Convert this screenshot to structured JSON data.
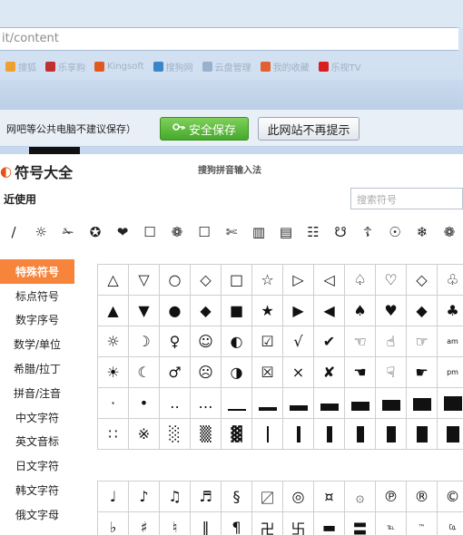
{
  "browser": {
    "url": "it/content",
    "bookmarks": [
      {
        "label": "搜狐",
        "color": "#f0a030"
      },
      {
        "label": "乐享购",
        "color": "#c03030"
      },
      {
        "label": "Kingsoft",
        "color": "#e05a20"
      },
      {
        "label": "搜狗网",
        "color": "#3a86c8"
      },
      {
        "label": "云盘管理",
        "color": "#9ab0cc"
      },
      {
        "label": "我的收藏",
        "color": "#e06030"
      },
      {
        "label": "乐视TV",
        "color": "#d81e1e"
      }
    ],
    "notice": {
      "text": "网吧等公共电脑不建议保存）",
      "save_label": "安全保存",
      "dismiss_label": "此网站不再提示"
    }
  },
  "ime": {
    "title": "符号大全",
    "subtitle": "搜狗拼音输入法",
    "recent_label": "近使用",
    "search_placeholder": "搜索符号",
    "recent_symbols": [
      "/",
      "☼",
      "✁",
      "✪",
      "❤",
      "☐",
      "❁",
      "☐",
      "✄",
      "▥",
      "▤",
      "☷",
      "☋",
      "☦",
      "☉",
      "❄",
      "❁"
    ],
    "sidebar": [
      {
        "label": "特殊符号",
        "active": true
      },
      {
        "label": "标点符号",
        "active": false
      },
      {
        "label": "数字序号",
        "active": false
      },
      {
        "label": "数学/单位",
        "active": false
      },
      {
        "label": "希腊/拉丁",
        "active": false
      },
      {
        "label": "拼音/注音",
        "active": false
      },
      {
        "label": "中文字符",
        "active": false
      },
      {
        "label": "英文音标",
        "active": false
      },
      {
        "label": "日文字符",
        "active": false
      },
      {
        "label": "韩文字符",
        "active": false
      },
      {
        "label": "俄文字母",
        "active": false
      }
    ],
    "grid_rows": [
      [
        "△",
        "▽",
        "○",
        "◇",
        "□",
        "☆",
        "▷",
        "◁",
        "♤",
        "♡",
        "◇",
        "♧"
      ],
      [
        "▲",
        "▼",
        "●",
        "◆",
        "■",
        "★",
        "▶",
        "◀",
        "♠",
        "♥",
        "◆",
        "♣"
      ],
      [
        "☼",
        "☽",
        "♀",
        "☺",
        "◐",
        "☑",
        "√",
        "✔",
        "☜",
        "☝",
        "☞",
        "am"
      ],
      [
        "☀",
        "☾",
        "♂",
        "☹",
        "◑",
        "☒",
        "×",
        "✘",
        "☚",
        "☟",
        "☛",
        "pm"
      ],
      [
        "·",
        "•",
        "‥",
        "…",
        "▁",
        "▂",
        "▃",
        "▄",
        "▅",
        "▆",
        "▇",
        "█"
      ],
      [
        "∷",
        "※",
        "░",
        "▒",
        "▓",
        "▏",
        "▎",
        "▍",
        "▌",
        "▋",
        "▊",
        "▉"
      ],
      [
        "♩",
        "♪",
        "♫",
        "♬",
        "§",
        "〼",
        "◎",
        "¤",
        "۞",
        "℗",
        "®",
        "©"
      ],
      [
        "♭",
        "♯",
        "♮",
        "‖",
        "¶",
        "卍",
        "卐",
        "▬",
        "〓",
        "℡",
        "™",
        "㏇"
      ]
    ]
  }
}
